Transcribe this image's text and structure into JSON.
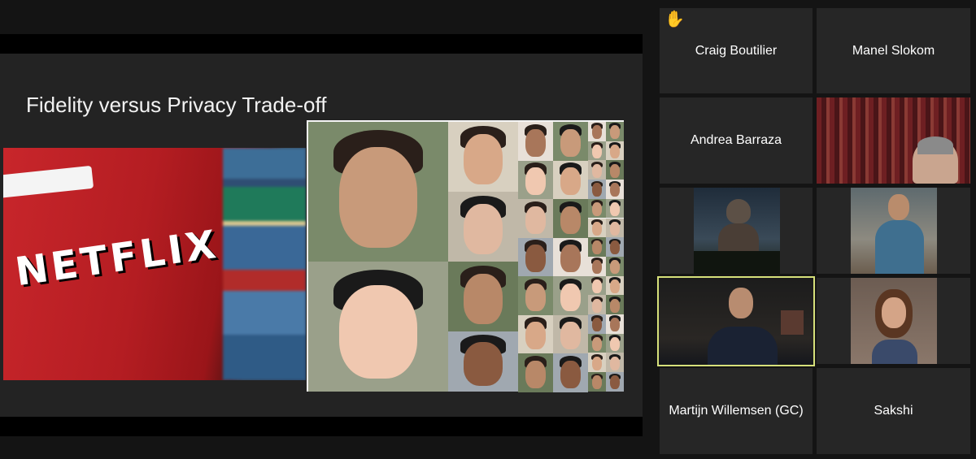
{
  "share": {
    "slide_title": "Fidelity versus Privacy Trade-off",
    "netflix_text": "NETFLIX"
  },
  "participants": [
    {
      "name": "Craig Boutilier",
      "hand_raised": true,
      "icon": "raised-hand-icon"
    },
    {
      "name": "Manel Slokom"
    },
    {
      "name": "Andrea Barraza"
    },
    {
      "name": ""
    },
    {
      "name": ""
    },
    {
      "name": ""
    },
    {
      "name": ""
    },
    {
      "name": ""
    },
    {
      "name": "Martijn Willemsen (GC)"
    },
    {
      "name": "Sakshi"
    }
  ],
  "colors": {
    "active_speaker_border": "#d6e07a",
    "tile_bg": "#262626",
    "app_bg": "#141414"
  }
}
